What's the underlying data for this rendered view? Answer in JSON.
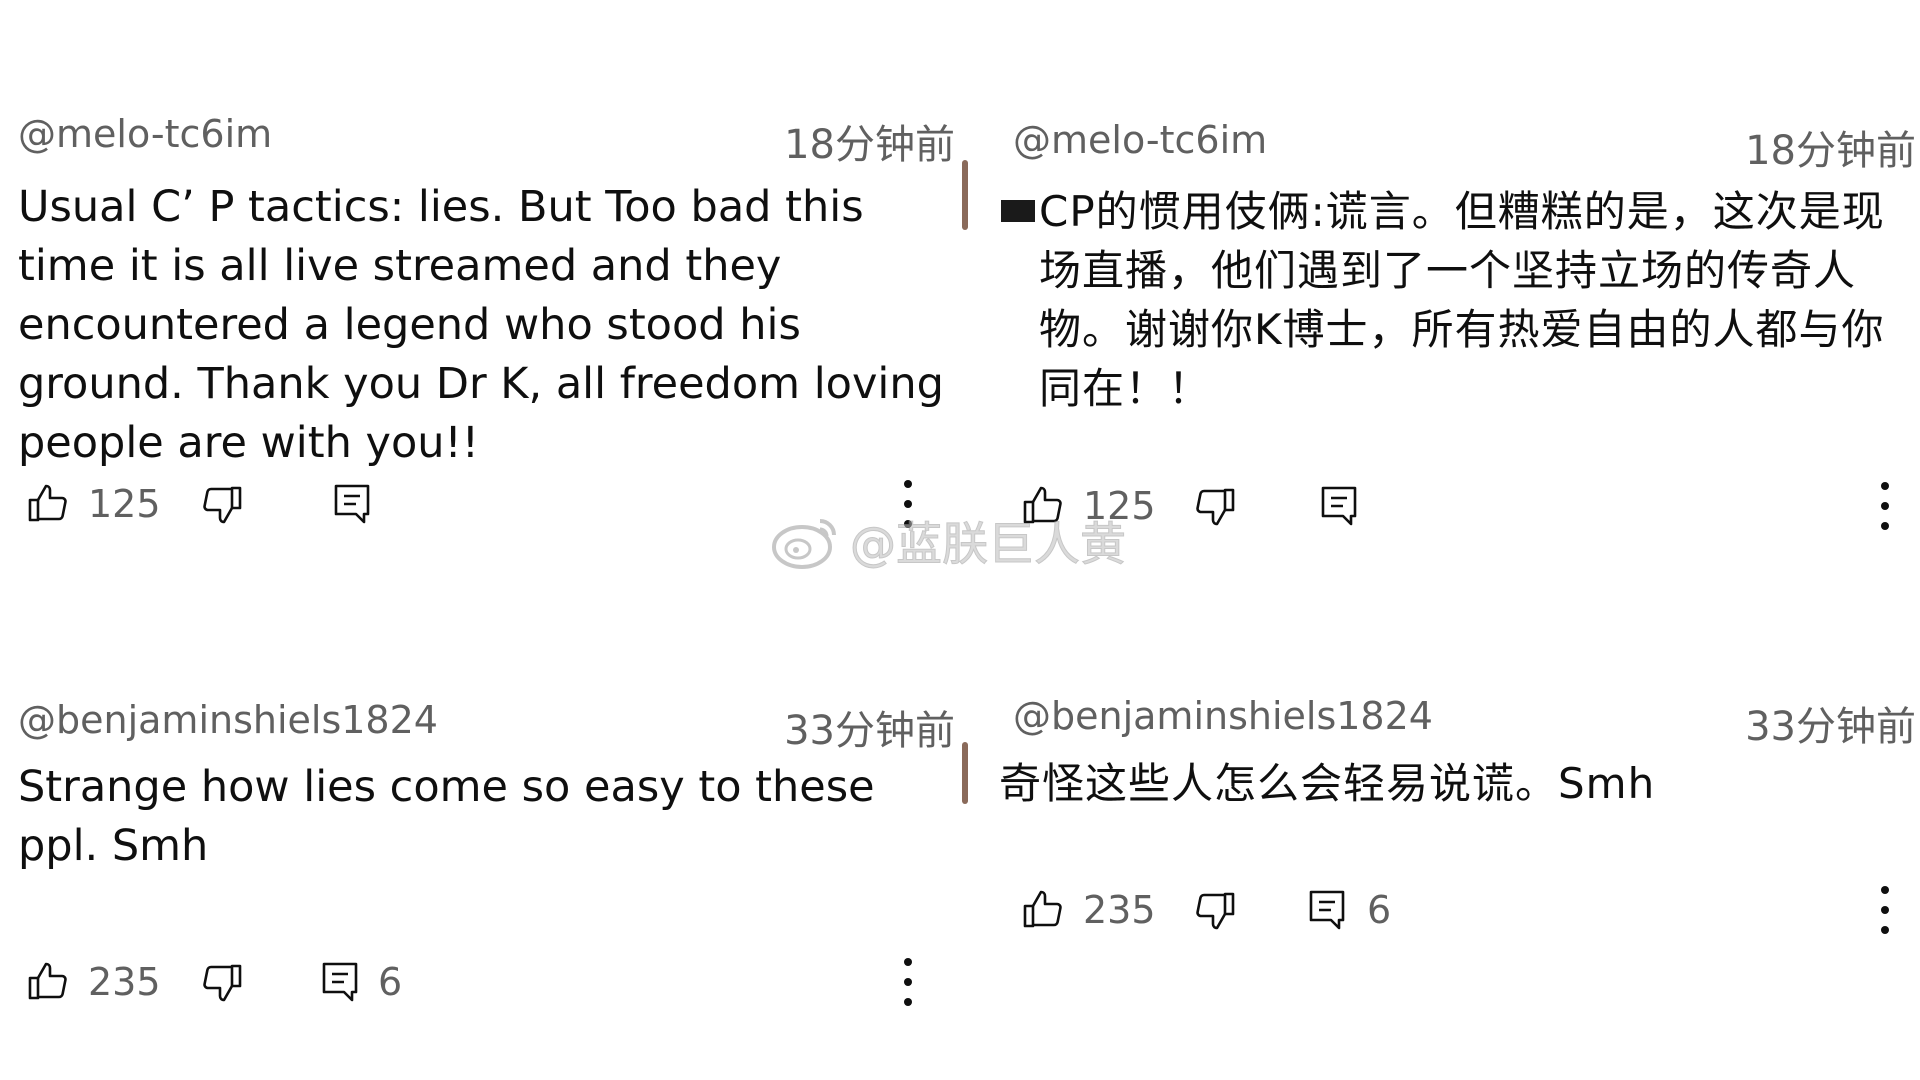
{
  "watermark": {
    "text": "@蓝朕巨人黄",
    "icon": "weibo-icon"
  },
  "panels": {
    "left": {
      "comments": [
        {
          "handle": "@melo-tc6im",
          "time": "18分钟前",
          "text": "Usual C’ P tactics: lies. But Too bad this time it is all live streamed and they encountered a legend who stood his ground. Thank you Dr K, all freedom loving people are with you!!",
          "likes": "125",
          "replies": ""
        },
        {
          "handle": "@benjaminshiels1824",
          "time": "33分钟前",
          "text": "Strange how lies come so easy to these ppl. Smh",
          "likes": "235",
          "replies": "6"
        }
      ]
    },
    "right": {
      "comments": [
        {
          "handle": "@melo-tc6im",
          "time": "18分钟前",
          "text": "CP的惯用伎俩:谎言。但糟糕的是，这次是现场直播，他们遇到了一个坚持立场的传奇人物。谢谢你K博士，所有热爱自由的人都与你同在！！",
          "likes": "125",
          "replies": ""
        },
        {
          "handle": "@benjaminshiels1824",
          "time": "33分钟前",
          "text": "奇怪这些人怎么会轻易说谎。Smh",
          "likes": "235",
          "replies": "6"
        }
      ]
    }
  },
  "icons": {
    "like": "thumbs-up-icon",
    "dislike": "thumbs-down-icon",
    "reply": "comment-icon",
    "more": "more-vertical-icon"
  },
  "colors": {
    "text": "#0f0f0f",
    "secondary": "#606060",
    "divider": "#ececec"
  }
}
